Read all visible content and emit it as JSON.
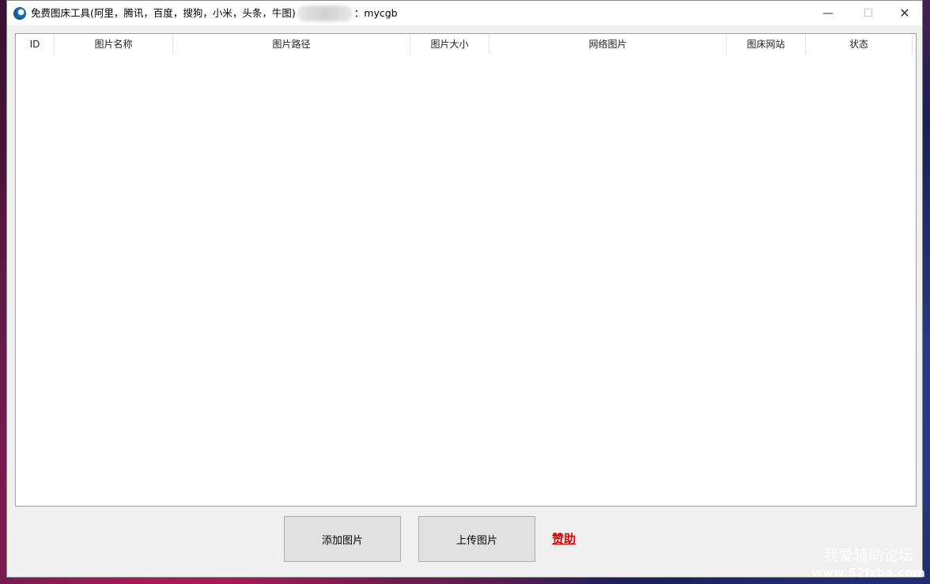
{
  "window": {
    "title": "免费图床工具(阿里，腾讯，百度，搜狗，小米，头条，牛图)",
    "title_suffix": "：mycgb",
    "minimize": "—",
    "maximize": "☐",
    "close": "✕"
  },
  "table": {
    "columns": [
      "ID",
      "图片名称",
      "图片路径",
      "图片大小",
      "网络图片",
      "图床网站",
      "状态"
    ],
    "rows": []
  },
  "buttons": {
    "add": "添加图片",
    "upload": "上传图片",
    "sponsor": "赞助"
  },
  "watermark": {
    "line1": "我爱辅助论坛",
    "line2": "www.52fzba.com"
  }
}
